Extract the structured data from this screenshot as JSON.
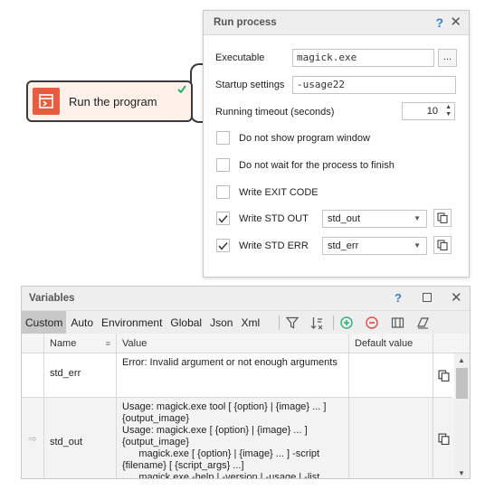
{
  "node": {
    "label": "Run the program"
  },
  "dialog": {
    "title": "Run process",
    "help": "?",
    "close": "✕",
    "executable_label": "Executable",
    "executable_value": "magick.exe",
    "browse_label": "...",
    "startup_label": "Startup settings",
    "startup_value": "-usage22",
    "timeout_label": "Running timeout (seconds)",
    "timeout_value": "10",
    "options": [
      {
        "label": "Do not show program window",
        "checked": false
      },
      {
        "label": "Do not wait for the process to finish",
        "checked": false
      },
      {
        "label": "Write EXIT CODE",
        "checked": false
      },
      {
        "label": "Write STD OUT",
        "checked": true,
        "variable": "std_out"
      },
      {
        "label": "Write STD ERR",
        "checked": true,
        "variable": "std_err"
      }
    ]
  },
  "variables": {
    "title": "Variables",
    "help": "?",
    "close": "✕",
    "tabs": [
      "Custom",
      "Auto",
      "Environment",
      "Global",
      "Json",
      "Xml"
    ],
    "active_tab": "Custom",
    "columns": [
      "Name",
      "Value",
      "Default value"
    ],
    "rows": [
      {
        "name": "std_err",
        "value": "Error: Invalid argument or not enough arguments",
        "default": ""
      },
      {
        "name": "std_out",
        "value": "Usage: magick.exe tool [ {option} | {image} ... ]\n{output_image}\nUsage: magick.exe [ {option} | {image} ... ]\n{output_image}\n      magick.exe [ {option} | {image} ... ] -script\n{filename} [ {script_args} ...]\n      magick.exe -help | -version | -usage | -list",
        "default": "",
        "marker": "⇨"
      }
    ]
  },
  "colors": {
    "accent": "#e85c3f",
    "check_green": "#2bb37a",
    "help_blue": "#2f7fd1",
    "add_green": "#2bb37a",
    "remove_red": "#e04848"
  }
}
